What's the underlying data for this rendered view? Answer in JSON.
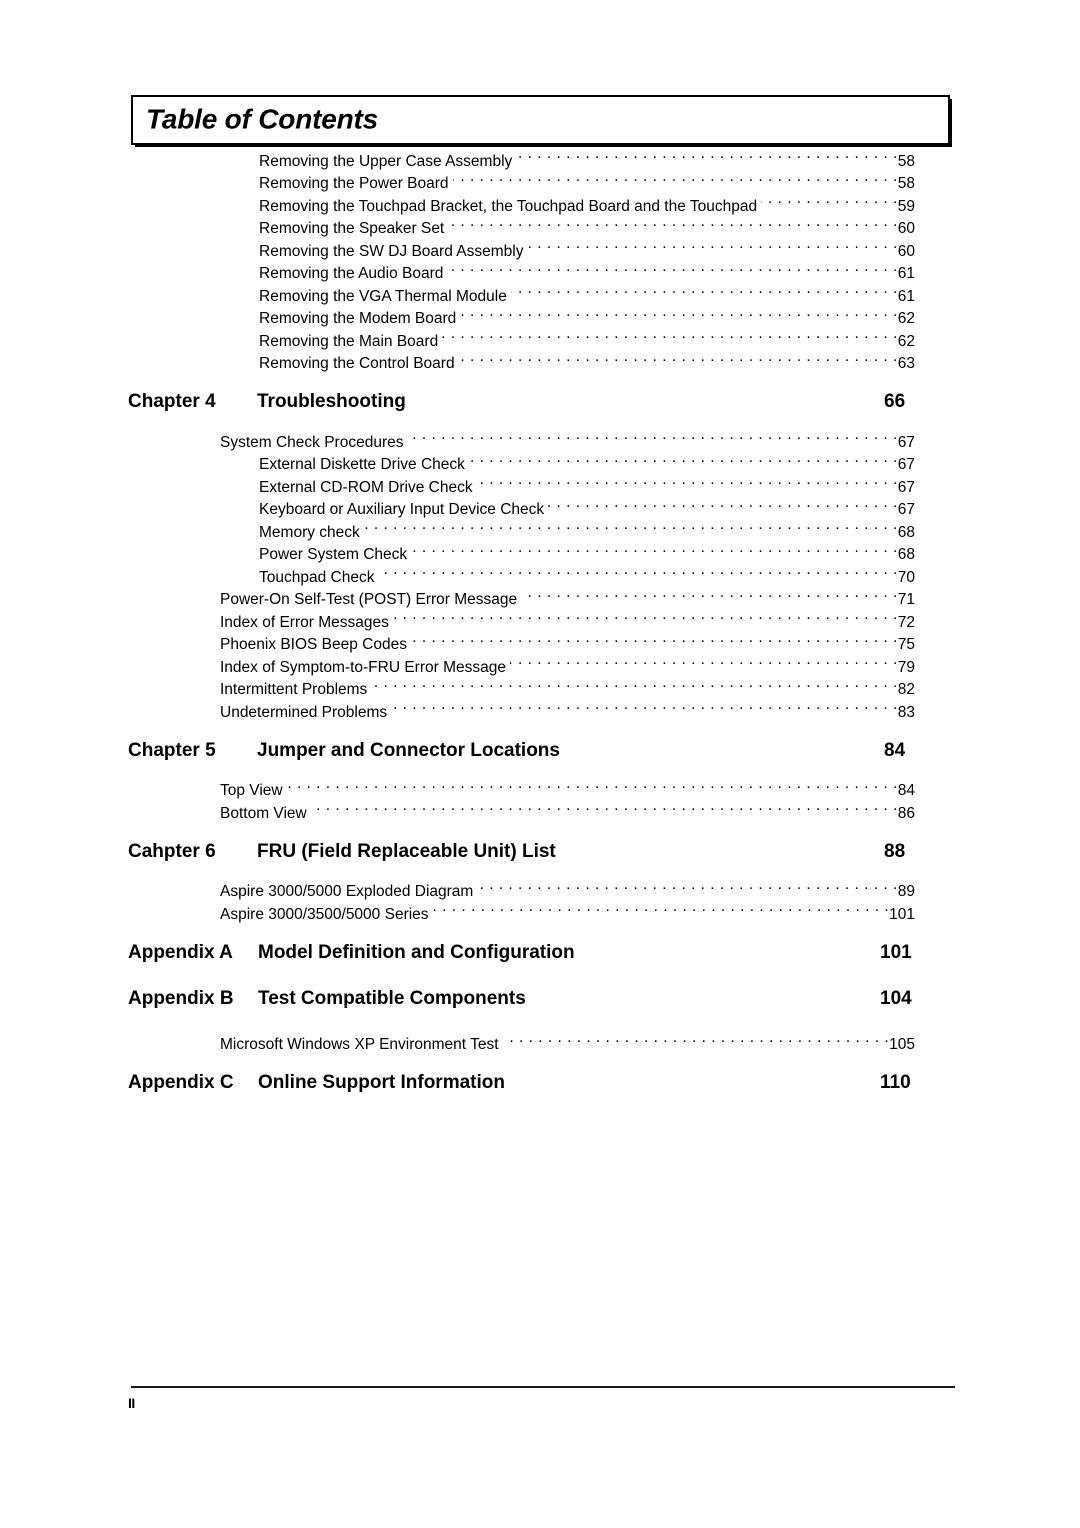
{
  "document": {
    "title": "Table of Contents",
    "footer_page_label": "II"
  },
  "sections": [
    {
      "type": "entry-group",
      "entries": [
        {
          "label": "Removing the Upper Case Assembly",
          "page": "58",
          "level": 2
        },
        {
          "label": "Removing the Power Board",
          "page": "58",
          "level": 2
        },
        {
          "label": "Removing the Touchpad Bracket, the Touchpad Board and the Touchpad",
          "page": "59",
          "level": 2
        },
        {
          "label": "Removing the Speaker Set",
          "page": "60",
          "level": 2
        },
        {
          "label": "Removing the SW DJ Board Assembly",
          "page": "60",
          "level": 2
        },
        {
          "label": "Removing the Audio Board",
          "page": "61",
          "level": 2
        },
        {
          "label": "Removing the VGA Thermal Module",
          "page": "61",
          "level": 2
        },
        {
          "label": "Removing the Modem Board",
          "page": "62",
          "level": 2
        },
        {
          "label": "Removing the Main Board",
          "page": "62",
          "level": 2
        },
        {
          "label": "Removing the Control Board",
          "page": "63",
          "level": 2
        }
      ]
    },
    {
      "type": "chapter",
      "label": "Chapter 4",
      "title": "Troubleshooting",
      "page": "66"
    },
    {
      "type": "entry-group",
      "entries": [
        {
          "label": "System Check Procedures",
          "page": "67",
          "level": 1
        },
        {
          "label": "External Diskette Drive Check",
          "page": "67",
          "level": 2
        },
        {
          "label": "External CD-ROM Drive Check",
          "page": "67",
          "level": 2
        },
        {
          "label": "Keyboard or Auxiliary Input Device Check",
          "page": "67",
          "level": 2
        },
        {
          "label": "Memory check",
          "page": "68",
          "level": 2
        },
        {
          "label": "Power System Check",
          "page": "68",
          "level": 2
        },
        {
          "label": "Touchpad Check",
          "page": "70",
          "level": 2
        },
        {
          "label": "Power-On Self-Test (POST) Error Message",
          "page": "71",
          "level": 1
        },
        {
          "label": "Index of Error Messages",
          "page": "72",
          "level": 1
        },
        {
          "label": "Phoenix BIOS Beep Codes",
          "page": "75",
          "level": 1
        },
        {
          "label": "Index of Symptom-to-FRU Error Message",
          "page": "79",
          "level": 1
        },
        {
          "label": "Intermittent Problems",
          "page": "82",
          "level": 1
        },
        {
          "label": "Undetermined Problems",
          "page": "83",
          "level": 1
        }
      ]
    },
    {
      "type": "chapter",
      "label": "Chapter 5",
      "title": "Jumper and Connector Locations",
      "page": "84"
    },
    {
      "type": "entry-group",
      "entries": [
        {
          "label": "Top View",
          "page": "84",
          "level": 1
        },
        {
          "label": "Bottom View",
          "page": "86",
          "level": 1
        }
      ]
    },
    {
      "type": "chapter",
      "label": "Cahpter 6",
      "title": "FRU (Field Replaceable Unit) List",
      "page": "88"
    },
    {
      "type": "entry-group",
      "entries": [
        {
          "label": "Aspire 3000/5000 Exploded Diagram",
          "page": "89",
          "level": 1
        },
        {
          "label": "Aspire 3000/3500/5000 Series",
          "page": "101",
          "level": 1
        }
      ]
    },
    {
      "type": "appendix",
      "label": "Appendix A",
      "title": "Model Definition and Configuration",
      "page": "101"
    },
    {
      "type": "appendix",
      "label": "Appendix B",
      "title": "Test Compatible Components",
      "page": "104"
    },
    {
      "type": "entry-group",
      "entries": [
        {
          "label": "Microsoft Windows XP Environment Test",
          "page": "105",
          "level": 1
        }
      ]
    },
    {
      "type": "appendix",
      "label": "Appendix C",
      "title": "Online Support Information",
      "page": "110"
    }
  ]
}
